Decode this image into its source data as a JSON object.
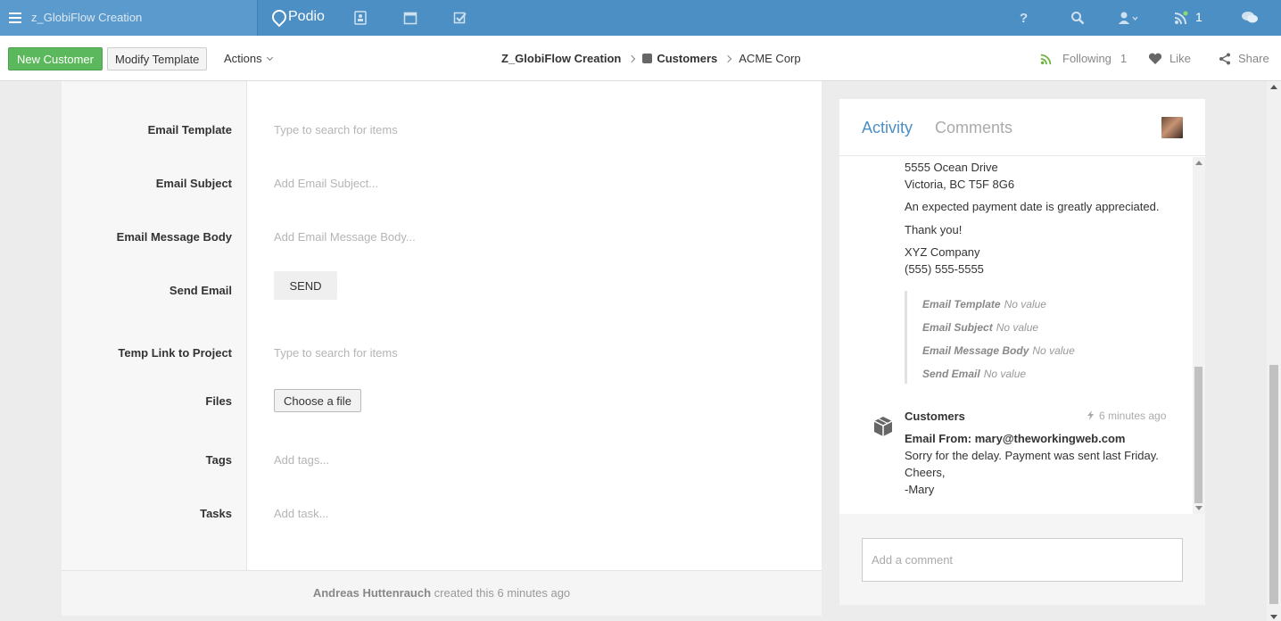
{
  "topbar": {
    "workspace": "z_GlobiFlow Creation",
    "app_name": "Podio",
    "notification_count": "1",
    "icons": [
      "menu-icon",
      "contacts-icon",
      "calendar-icon",
      "tasks-icon",
      "help-icon",
      "search-icon",
      "user-icon",
      "notifications-icon",
      "chat-icon"
    ]
  },
  "actionbar": {
    "new_button": "New Customer",
    "modify_button": "Modify Template",
    "actions_label": "Actions",
    "breadcrumb": {
      "workspace": "Z_GlobiFlow Creation",
      "app": "Customers",
      "item": "ACME Corp"
    },
    "following_label": "Following",
    "following_count": "1",
    "like_label": "Like",
    "share_label": "Share"
  },
  "fields": [
    {
      "label": "Email Template",
      "placeholder": "Type to search for items"
    },
    {
      "label": "Email Subject",
      "placeholder": "Add Email Subject..."
    },
    {
      "label": "Email Message Body",
      "placeholder": "Add Email Message Body..."
    },
    {
      "label": "Send Email",
      "button": "SEND"
    },
    {
      "label": "Temp Link to Project",
      "placeholder": "Type to search for items"
    },
    {
      "label": "Files",
      "button": "Choose a file"
    },
    {
      "label": "Tags",
      "placeholder": "Add tags..."
    },
    {
      "label": "Tasks",
      "placeholder": "Add task..."
    }
  ],
  "footer": {
    "author": "Andreas Huttenrauch",
    "action": "created this 6 minutes ago"
  },
  "activity": {
    "tab_activity": "Activity",
    "tab_comments": "Comments",
    "lines": [
      "5555 Ocean Drive",
      "Victoria, BC T5F 8G6",
      "An expected payment date is greatly appreciated.",
      "Thank you!",
      "XYZ Company",
      "(555) 555-5555"
    ],
    "changes": [
      {
        "field": "Email Template",
        "value": "No value"
      },
      {
        "field": "Email Subject",
        "value": "No value"
      },
      {
        "field": "Email Message Body",
        "value": "No value"
      },
      {
        "field": "Send Email",
        "value": "No value"
      }
    ],
    "entry": {
      "author": "Customers",
      "time": "6 minutes ago",
      "email_from": "Email From:  mary@theworkingweb.com",
      "message": [
        "Sorry for the delay. Payment was sent last Friday.",
        "Cheers,",
        "-Mary"
      ]
    },
    "comment_placeholder": "Add a comment"
  }
}
